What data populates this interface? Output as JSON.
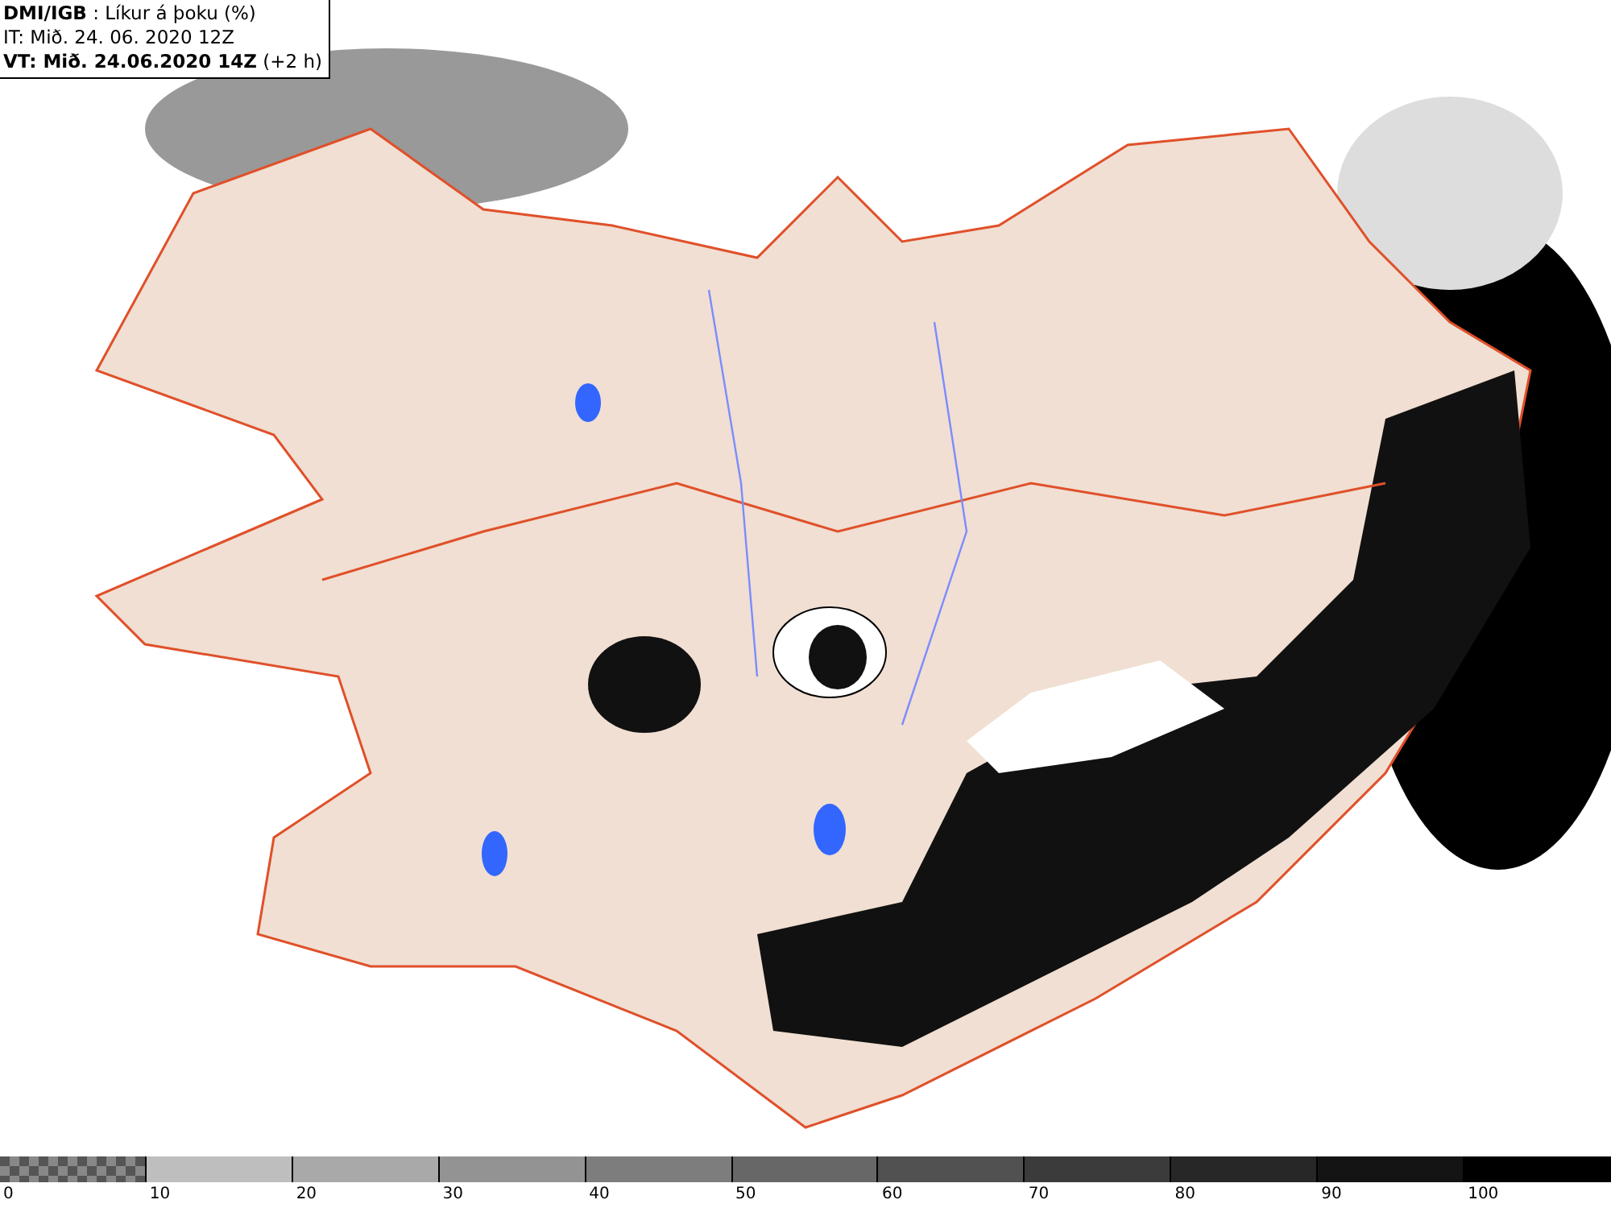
{
  "legend": {
    "lines": [
      "**DMI/IGB** : Líkur á þoku (%)",
      "IT: Mið. 24. 06. 2020 12Z",
      "**VT: Mið. 24.06.2020 14Z** (+2 h)"
    ]
  },
  "colorbar": {
    "segments": [
      {
        "kind": "checker",
        "color": "#8a8a8a"
      },
      {
        "kind": "solid",
        "color": "#bebebe"
      },
      {
        "kind": "solid",
        "color": "#a9a9a9"
      },
      {
        "kind": "solid",
        "color": "#939393"
      },
      {
        "kind": "solid",
        "color": "#7d7d7d"
      },
      {
        "kind": "solid",
        "color": "#676767"
      },
      {
        "kind": "solid",
        "color": "#515151"
      },
      {
        "kind": "solid",
        "color": "#3b3b3b"
      },
      {
        "kind": "solid",
        "color": "#272727"
      },
      {
        "kind": "solid",
        "color": "#141414"
      },
      {
        "kind": "solid",
        "color": "#000000"
      }
    ],
    "labels": [
      "0",
      "10",
      "20",
      "30",
      "40",
      "50",
      "60",
      "70",
      "80",
      "90",
      "100"
    ]
  }
}
